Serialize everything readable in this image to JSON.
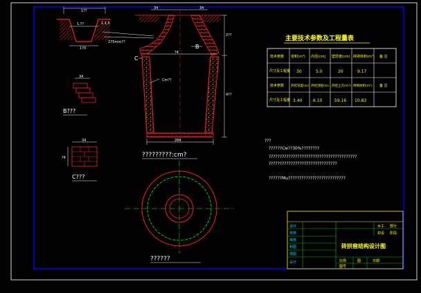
{
  "colors": {
    "background": "#000000",
    "outer_frame": "#d8d8d8",
    "inner_frame": "#0000ff",
    "structure": "#ff2020",
    "dim": "#ffffff",
    "table_line": "#ffffff",
    "title_yellow": "#ffff00",
    "green": "#00c000",
    "cyan": "#00d0ff",
    "dashed_green": "#00ff00"
  },
  "drawing": {
    "top_detail": {
      "dim_top": "1??",
      "dim_mid": "1.??",
      "dim_bottom": "1?0",
      "leader_note": "275mm??",
      "slope": "1:1.5"
    },
    "main": {
      "dim_top_left": "34",
      "dim_top_right": "34",
      "dim_mid": "?4",
      "dim_bottom": "284",
      "dim_right_a": "2??",
      "dim_right_b": "4??",
      "label_c": "C",
      "label_b": "B",
      "inner_note": "Cm??",
      "caption": "?????????:cm?"
    },
    "detail_b": {
      "dim": "34",
      "caption": "B???"
    },
    "detail_c": {
      "dim_top": "34",
      "dim_side": "?4",
      "caption": "C???"
    },
    "plan": {
      "caption": "??????"
    }
  },
  "table": {
    "title": "主要技术参数及工程量表",
    "row1": [
      "技术参数",
      "容积(m³)",
      "内径(cm)",
      "壁厚度(cm)",
      "砖砌体积(m³)",
      "备 注"
    ],
    "row2": [
      "尺寸及工程量",
      "30",
      "5.0",
      "20",
      "9.17",
      ""
    ],
    "row3": [
      "技术参数",
      "开挖深度(m)",
      "开挖顶径(m)",
      "开挖土方(m³)",
      "砖砌体积(m³)",
      "备 注"
    ],
    "row4": [
      "尺寸及工程量",
      "3.40",
      "6.10",
      "59.16",
      "10.83",
      ""
    ]
  },
  "notes": {
    "heading": "???",
    "line1": "??????Cм??30%????????",
    "line2": "????????????????????????????????????????",
    "line3": "???????????????????????????????",
    "line4": "??????Mu??????????????????????????"
  },
  "title_block": {
    "r1": "设计",
    "r2": "校核",
    "r3": "审核",
    "r4": "制图",
    "r5": "描图",
    "r6": "设计",
    "unit_a": "水工",
    "unit_b": "部分",
    "unit_c": "初设",
    "unit_d": "阶段",
    "drawing_title": "砖拱窖结构设计图",
    "scale_label": "比例",
    "sheet_label": "图",
    "no_label": "图号",
    "date_label": "日期"
  }
}
